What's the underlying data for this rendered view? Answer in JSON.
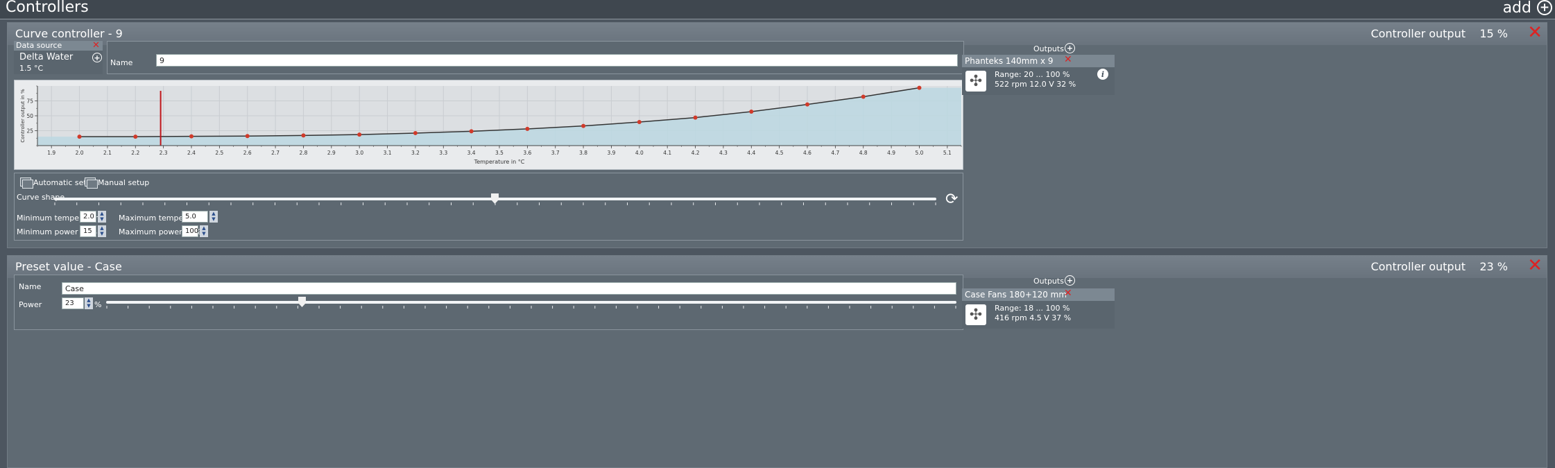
{
  "app": {
    "title": "Controllers",
    "add_label": "add"
  },
  "controllers": [
    {
      "title": "Curve controller  -  9",
      "output_label": "Controller output",
      "output_value": "15 %",
      "data_source": {
        "header": "Data source",
        "name": "Delta Water",
        "value": "1.5 °C"
      },
      "name_label": "Name",
      "name_value": "9",
      "setup": {
        "auto_label": "Automatic setup",
        "manual_label": "Manual setup"
      },
      "curve_shape_label": "Curve shape",
      "curve_shape_position": 0.5,
      "min_temp_label": "Minimum temperature",
      "min_temp_value": "2.0",
      "max_temp_label": "Maximum temperature",
      "max_temp_value": "5.0",
      "min_power_label": "Minimum power in %",
      "min_power_value": "15",
      "max_power_label": "Maximum power in %",
      "max_power_value": "100",
      "outputs_label": "Outputs",
      "outputs": [
        {
          "name": "Phanteks 140mm x 9",
          "range": "Range:  20 ... 100  %",
          "stats": "522 rpm  12.0 V  32 %",
          "icon": "fan-icon"
        }
      ]
    },
    {
      "title": "Preset value  -  Case",
      "output_label": "Controller output",
      "output_value": "23 %",
      "name_label": "Name",
      "name_value": "Case",
      "power_label": "Power",
      "power_value": "23",
      "power_unit": "%",
      "power_fraction": 0.23,
      "outputs_label": "Outputs",
      "outputs": [
        {
          "name": "Case Fans 180+120 mm",
          "range": "Range:  18 ... 100  %",
          "stats": "416 rpm  4.5 V  37 %",
          "icon": "fan-icon"
        }
      ]
    }
  ],
  "chart_data": {
    "type": "line",
    "xlabel": "Temperature in °C",
    "ylabel": "Controller output in %",
    "xlim": [
      1.85,
      5.15
    ],
    "ylim": [
      0,
      100
    ],
    "x_ticks": [
      "1.9",
      "2.0",
      "2.1",
      "2.2",
      "2.3",
      "2.4",
      "2.5",
      "2.6",
      "2.7",
      "2.8",
      "2.9",
      "3.0",
      "3.1",
      "3.2",
      "3.3",
      "3.4",
      "3.5",
      "3.6",
      "3.7",
      "3.8",
      "3.9",
      "4.0",
      "4.1",
      "4.2",
      "4.3",
      "4.4",
      "4.5",
      "4.6",
      "4.7",
      "4.8",
      "4.9",
      "5.0",
      "5.1"
    ],
    "y_ticks": [
      "25",
      "50",
      "75"
    ],
    "current_temperature": 2.29,
    "series": [
      {
        "x": [
          2.0,
          2.2,
          2.4,
          2.6,
          2.8,
          3.0,
          3.2,
          3.4,
          3.6,
          3.8,
          4.0,
          4.2,
          4.4,
          4.6,
          4.8,
          5.0
        ],
        "values": [
          15,
          15,
          15.5,
          16,
          17,
          18.5,
          21,
          24,
          28,
          33,
          39.5,
          47,
          57,
          69,
          82,
          97
        ]
      }
    ],
    "grid": true,
    "colors": {
      "line": "#333333",
      "points": "#d03a2a",
      "fill": "#bcd8e2",
      "current": "#c0161b"
    }
  }
}
